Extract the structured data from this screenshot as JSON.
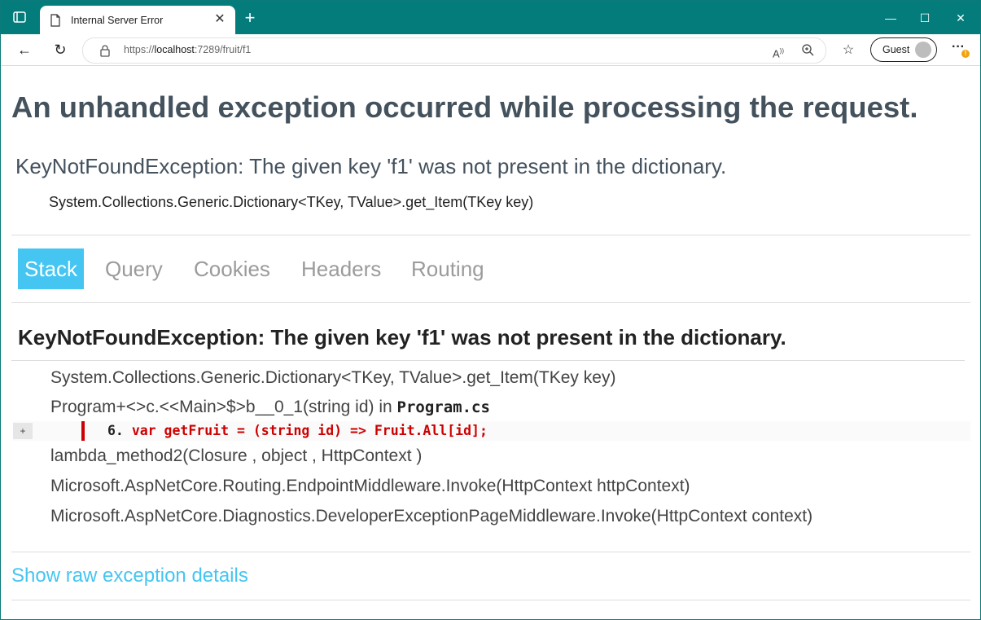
{
  "browser": {
    "tab_title": "Internal Server Error",
    "url_prefix": "https://",
    "url_host": "localhost",
    "url_rest": ":7289/fruit/f1",
    "profile_label": "Guest",
    "notification_badge": "!",
    "accent_color": "#047c7c"
  },
  "page": {
    "title": "An unhandled exception occurred while processing the request.",
    "error_message": "KeyNotFoundException: The given key 'f1' was not present in the dictionary.",
    "error_location": "System.Collections.Generic.Dictionary<TKey, TValue>.get_Item(TKey key)",
    "tabs": [
      {
        "label": "Stack",
        "active": true
      },
      {
        "label": "Query",
        "active": false
      },
      {
        "label": "Cookies",
        "active": false
      },
      {
        "label": "Headers",
        "active": false
      },
      {
        "label": "Routing",
        "active": false
      }
    ],
    "stack_title": "KeyNotFoundException: The given key 'f1' was not present in the dictionary.",
    "frames": [
      {
        "text": "System.Collections.Generic.Dictionary<TKey, TValue>.get_Item(TKey key)"
      },
      {
        "text": "Program+<>c.<<Main>$>b__0_1(string id) in ",
        "file": "Program.cs"
      },
      {
        "text": "lambda_method2(Closure , object , HttpContext )"
      },
      {
        "text": "Microsoft.AspNetCore.Routing.EndpointMiddleware.Invoke(HttpContext httpContext)"
      },
      {
        "text": "Microsoft.AspNetCore.Diagnostics.DeveloperExceptionPageMiddleware.Invoke(HttpContext context)"
      }
    ],
    "source_line": {
      "expand_label": "+",
      "line_number": "6.",
      "code": "var getFruit = (string id) => Fruit.All[id];"
    },
    "raw_link": "Show raw exception details",
    "active_tab_color": "#44c5f2",
    "error_code_color": "#cc0000"
  }
}
